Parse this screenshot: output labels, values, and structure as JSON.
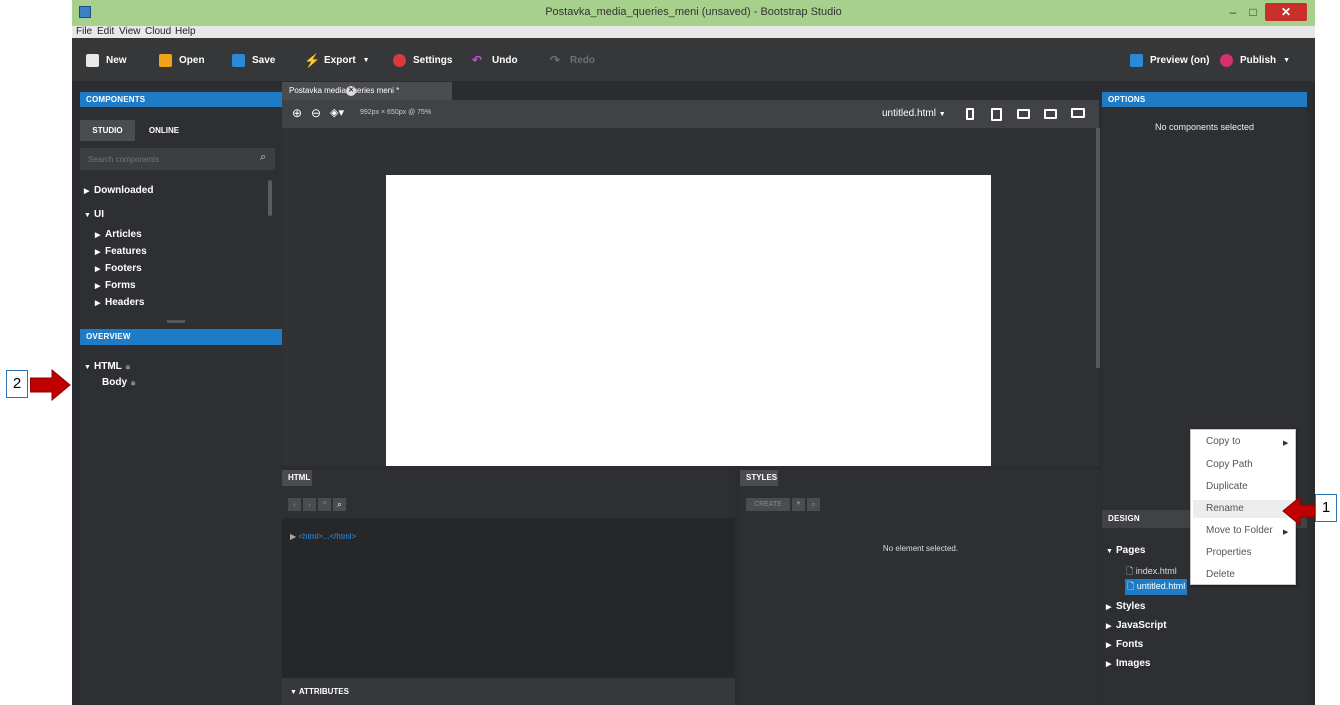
{
  "window": {
    "title": "Postavka_media_queries_meni (unsaved) - Bootstrap Studio",
    "minimize": "–",
    "maximize": "□",
    "close": "✕"
  },
  "menubar": [
    "File",
    "Edit",
    "View",
    "Cloud",
    "Help"
  ],
  "toolbar": {
    "new": "New",
    "open": "Open",
    "save": "Save",
    "export": "Export",
    "settings": "Settings",
    "undo": "Undo",
    "redo": "Redo",
    "preview": "Preview (on)",
    "publish": "Publish"
  },
  "components": {
    "header": "COMPONENTS",
    "tabs": [
      "STUDIO",
      "ONLINE"
    ],
    "search_placeholder": "Search components",
    "tree": [
      {
        "label": "Downloaded",
        "expanded": false
      },
      {
        "label": "UI",
        "expanded": true
      },
      {
        "label": "Articles",
        "expanded": false
      },
      {
        "label": "Features",
        "expanded": false
      },
      {
        "label": "Footers",
        "expanded": false
      },
      {
        "label": "Forms",
        "expanded": false
      },
      {
        "label": "Headers",
        "expanded": false
      }
    ]
  },
  "overview": {
    "header": "OVERVIEW",
    "html": "HTML",
    "body": "Body"
  },
  "document": {
    "tab_label": "Postavka media queries meni *",
    "size_info": "992px × 650px @ 75%",
    "page_select": "untitled.html"
  },
  "html_panel": {
    "tab": "HTML",
    "code": "<html>...</html>",
    "attributes": "ATTRIBUTES"
  },
  "styles_panel": {
    "tab": "STYLES",
    "create": "CREATE",
    "empty": "No element selected."
  },
  "options": {
    "header": "OPTIONS",
    "empty": "No components selected"
  },
  "design": {
    "header": "DESIGN",
    "pages_label": "Pages",
    "pages": [
      "index.html",
      "untitled.html"
    ],
    "sections": [
      "Styles",
      "JavaScript",
      "Fonts",
      "Images"
    ]
  },
  "context_menu": {
    "items": [
      "Copy to",
      "Copy Path",
      "Duplicate",
      "Rename",
      "Move to Folder",
      "Properties",
      "Delete"
    ],
    "highlighted": "Rename"
  },
  "annotations": {
    "callout_1": "1",
    "callout_2": "2"
  },
  "colors": {
    "accent_blue": "#1e7bc6",
    "titlebar_green": "#a8d08d",
    "annotation_red": "#c00000"
  }
}
